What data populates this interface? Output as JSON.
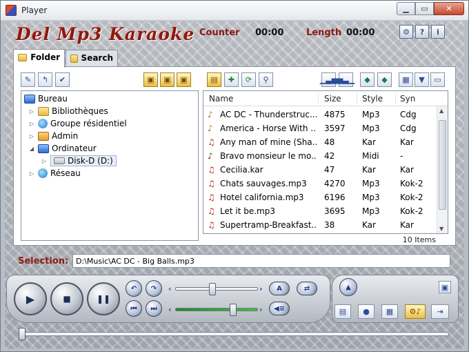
{
  "window": {
    "title": "Player"
  },
  "header": {
    "logo": "Del Mp3 Karaoke",
    "counter_label": "Counter",
    "counter_value": "00:00",
    "length_label": "Length",
    "length_value": "00:00",
    "buttons": [
      "gear-icon",
      "help-icon",
      "info-icon"
    ]
  },
  "tabs": [
    {
      "label": "Folder",
      "active": true
    },
    {
      "label": "Search",
      "active": false
    }
  ],
  "tree": {
    "items": [
      {
        "label": "Bureau",
        "icon": "monitor-icon",
        "level": 0
      },
      {
        "label": "Bibliothèques",
        "icon": "library-icon",
        "level": 1
      },
      {
        "label": "Groupe résidentiel",
        "icon": "homegroup-icon",
        "level": 1
      },
      {
        "label": "Admin",
        "icon": "user-folder-icon",
        "level": 1
      },
      {
        "label": "Ordinateur",
        "icon": "computer-icon",
        "level": 1
      },
      {
        "label": "Disk-D (D:)",
        "icon": "drive-icon",
        "level": 2
      },
      {
        "label": "Réseau",
        "icon": "network-icon",
        "level": 1
      }
    ]
  },
  "filelist": {
    "columns": [
      "Name",
      "Size",
      "Style",
      "Syn"
    ],
    "rows": [
      {
        "name": "AC DC - Thunderstruc...",
        "size": "4875",
        "style": "Mp3",
        "syn": "Cdg",
        "icon": "note-yellow"
      },
      {
        "name": "America - Horse With ...",
        "size": "3597",
        "style": "Mp3",
        "syn": "Cdg",
        "icon": "note-yellow"
      },
      {
        "name": "Any man of mine (Sha...",
        "size": "48",
        "style": "Kar",
        "syn": "Kar",
        "icon": "note-red"
      },
      {
        "name": "Bravo monsieur le mo...",
        "size": "42",
        "style": "Midi",
        "syn": "-",
        "icon": "note-brown"
      },
      {
        "name": "Cecilia.kar",
        "size": "47",
        "style": "Kar",
        "syn": "Kar",
        "icon": "note-red"
      },
      {
        "name": "Chats sauvages.mp3",
        "size": "4270",
        "style": "Mp3",
        "syn": "Kok-2",
        "icon": "note-red"
      },
      {
        "name": "Hotel california.mp3",
        "size": "6196",
        "style": "Mp3",
        "syn": "Kok-2",
        "icon": "note-red"
      },
      {
        "name": "Let it be.mp3",
        "size": "3695",
        "style": "Mp3",
        "syn": "Kok-2",
        "icon": "note-red"
      },
      {
        "name": "Supertramp-Breakfast...",
        "size": "38",
        "style": "Kar",
        "syn": "Kar",
        "icon": "note-red"
      }
    ],
    "count": "10 Items"
  },
  "selection": {
    "label": "Selection:",
    "value": "D:\\Music\\AC DC - Big Balls.mp3"
  },
  "player": {
    "volume": 0.45,
    "pitch": 0.7,
    "seek": 0.0
  },
  "colors": {
    "accent": "#8a1a12",
    "button_blue": "#2a4a9a"
  }
}
